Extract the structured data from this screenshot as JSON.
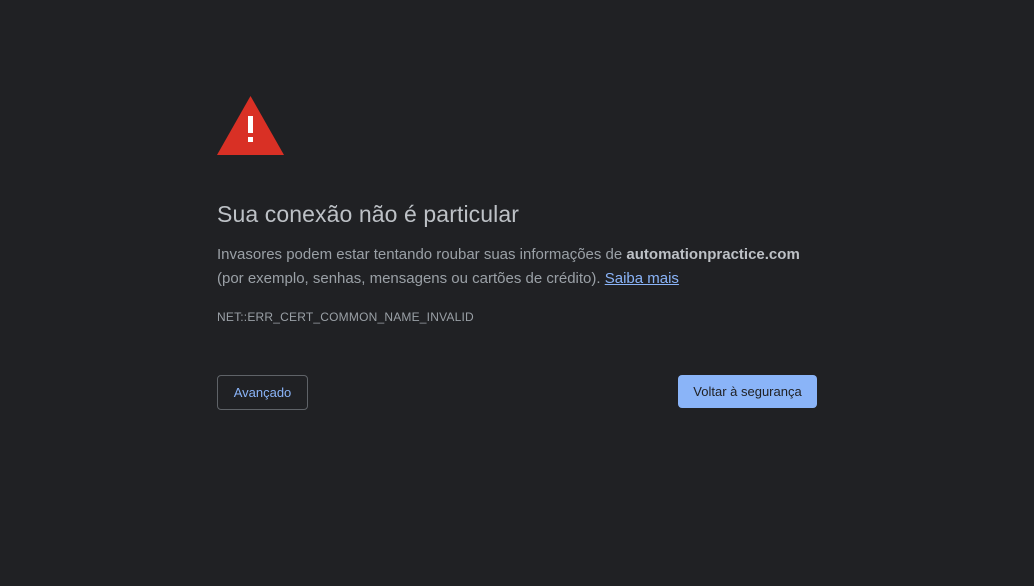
{
  "icon": "warning-triangle-icon",
  "colors": {
    "background": "#202124",
    "warning_red": "#d93025",
    "accent_blue": "#8ab4f8",
    "title_text": "#bdc1c6",
    "body_text": "#9aa0a6"
  },
  "title": "Sua conexão não é particular",
  "explanation": {
    "text_before": "Invasores podem estar tentando roubar suas informações de ",
    "domain": "automationpractice.com",
    "text_after": " (por exemplo, senhas, mensagens ou cartões de crédito). ",
    "learn_more": "Saiba mais"
  },
  "error_code": "NET::ERR_CERT_COMMON_NAME_INVALID",
  "buttons": {
    "advanced": "Avançado",
    "back_to_safety": "Voltar à segurança"
  }
}
